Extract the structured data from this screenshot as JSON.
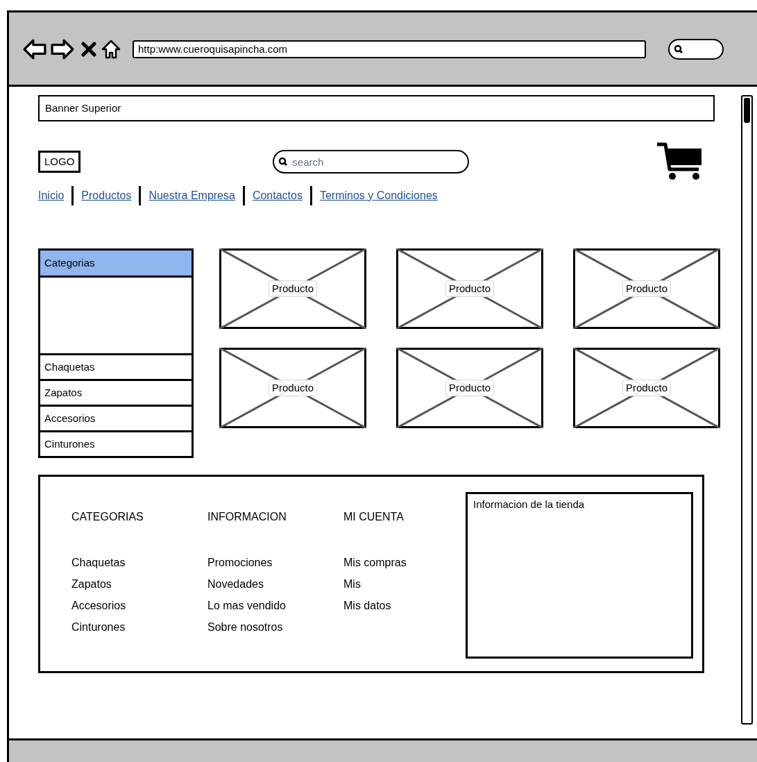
{
  "browser": {
    "url": "http:www.cueroquisapincha.com"
  },
  "banner": "Banner Superior",
  "logo": "LOGO",
  "search": {
    "placeholder": "search"
  },
  "nav": [
    "Inicio",
    "Productos",
    "Nuestra Empresa",
    "Contactos",
    "Terminos y Condiciones"
  ],
  "sidebar": {
    "header": {
      "label": "Categorias",
      "selected": true
    },
    "items": [
      {
        "label": "Chaquetas",
        "selected": false
      },
      {
        "label": "Zapatos",
        "selected": false
      },
      {
        "label": "Accesorios",
        "selected": false
      },
      {
        "label": "Cinturones",
        "selected": false
      }
    ]
  },
  "products": [
    "Producto",
    "Producto",
    "Producto",
    "Producto",
    "Producto",
    "Producto"
  ],
  "footer": {
    "columns": [
      {
        "heading": "CATEGORIAS",
        "links": [
          "Chaquetas",
          "Zapatos",
          "Accesorios",
          "Cinturones"
        ]
      },
      {
        "heading": "INFORMACION",
        "links": [
          "Promociones",
          "Novedades",
          "Lo mas vendido",
          "Sobre nosotros"
        ]
      },
      {
        "heading": "MI CUENTA",
        "links": [
          "Mis compras",
          "Mis",
          "Mis datos"
        ]
      }
    ],
    "store_info": "Informacion de la tienda"
  }
}
